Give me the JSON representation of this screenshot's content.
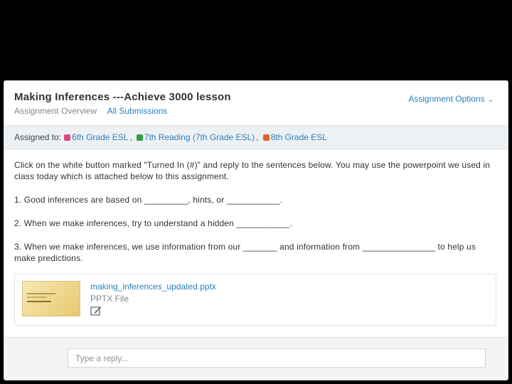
{
  "assignment": {
    "title": "Making Inferences ---Achieve 3000 lesson",
    "tabs": [
      "Assignment Overview",
      "All Submissions"
    ],
    "options_label": "Assignment Options",
    "assigned_label": "Assigned to:",
    "classes": [
      {
        "name": "6th Grade ESL",
        "color": "#e2457a"
      },
      {
        "name": "7th Reading (7th Grade ESL)",
        "color": "#2ea043"
      },
      {
        "name": "8th Grade ESL",
        "color": "#d9662b"
      }
    ],
    "paragraphs": [
      "Click on the white button marked \"Turned In (#)\" and reply to the sentences below. You may use the powerpoint we used in class today which is attached below to this assignment.",
      "1. Good inferences are based on _________, hints, or ___________.",
      "2. When we make inferences, try to understand a hidden ___________.",
      "3. When we make inferences, we use information from our _______ and information from _______________ to help us make predictions."
    ]
  },
  "attachment": {
    "filename": "making_inferences_updated.pptx",
    "filetype": "PPTX File",
    "thumb_icon": "presentation-thumbnail",
    "edit_icon": "edit-icon"
  },
  "reply": {
    "placeholder": "Type a reply..."
  },
  "colors": {
    "link": "#2a80b9",
    "muted": "#7c8790"
  }
}
